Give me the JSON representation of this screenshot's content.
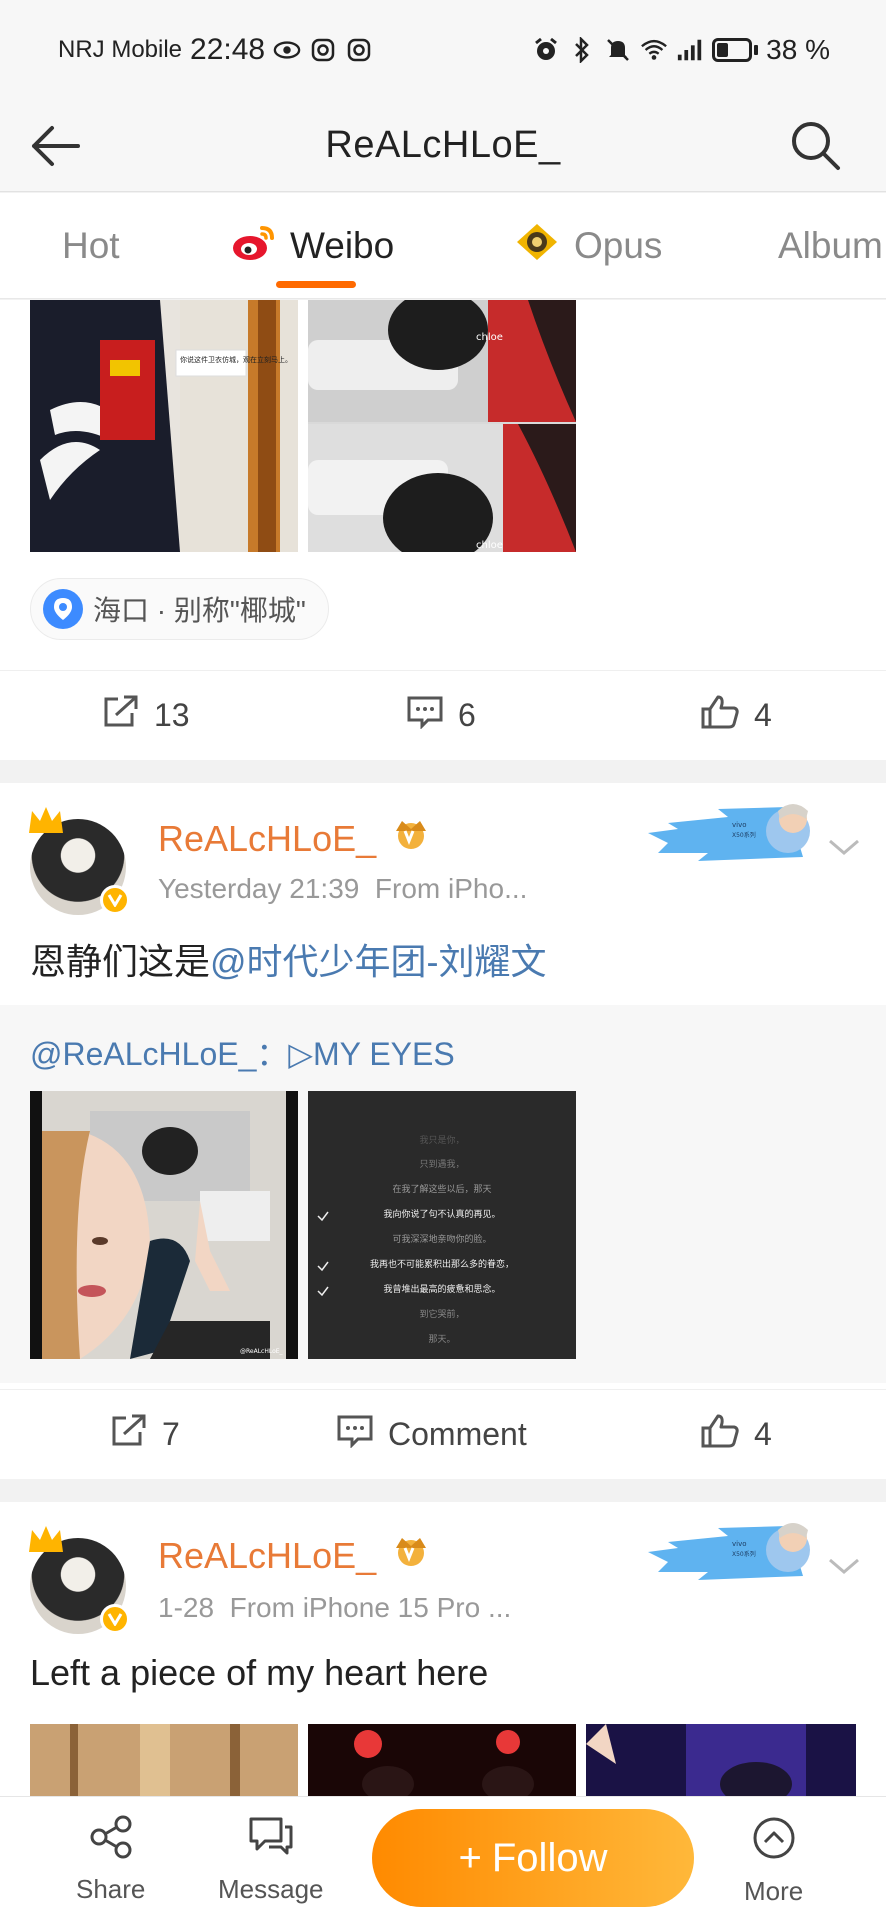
{
  "status_bar": {
    "carrier": "NRJ Mobile",
    "time": "22:48",
    "battery_percent": "38 %",
    "battery_level": 0.38,
    "icons": [
      "eye-icon",
      "instagram-icon",
      "instagram-icon",
      "alarm-icon",
      "bluetooth-icon",
      "mute-icon",
      "wifi-icon",
      "signal-icon",
      "battery-icon"
    ]
  },
  "header": {
    "title": "ReALcHLoE_",
    "back_icon": "arrow-left-icon",
    "search_icon": "search-icon"
  },
  "tabs": [
    {
      "label": "Hot",
      "active": false
    },
    {
      "label": "Weibo",
      "active": true,
      "icon": "weibo-logo-icon"
    },
    {
      "label": "Opus",
      "active": false,
      "icon": "opus-icon"
    },
    {
      "label": "Album",
      "active": false
    }
  ],
  "accent_color": "#ff6a00",
  "post1": {
    "image_texts": [
      "你说这件卫衣仿城，观在立刻马上。",
      "chloe",
      "chloe"
    ],
    "location": "海口 · 别称\"椰城\"",
    "repost_count": "13",
    "comment_count": "6",
    "like_count": "4"
  },
  "post2": {
    "username": "ReALcHLoE_",
    "time": "Yesterday 21:39",
    "source": "From iPho...",
    "text_prefix": "恩静们这是",
    "mention": "@时代少年团-刘耀文",
    "ad_text": "vivo",
    "ad_text2": "X50系列",
    "repost_author": "@ReALcHLoE_",
    "repost_sep": "：",
    "repost_text": "▷MY EYES",
    "image_texts": [
      "@ReALcHLoE_",
      "我只是你，",
      "只到遇我，",
      "在我了解这些以后，那天",
      "我向你说了句不认真的再见。",
      "可我深深地亲吻你的脸。",
      "我再也不可能累积出那么多的眷恋，",
      "我曾堆出最高的疲惫和思念。",
      "到它哭前，",
      "那天。"
    ],
    "repost_count": "7",
    "comment_label": "Comment",
    "like_count": "4"
  },
  "post3": {
    "username": "ReALcHLoE_",
    "time": "1-28",
    "source": "From iPhone 15 Pro ...",
    "text": "Left a piece of my heart here",
    "ad_text": "vivo",
    "ad_text2": "X50系列"
  },
  "bottom_bar": {
    "share_label": "Share",
    "message_label": "Message",
    "follow_label": "Follow",
    "follow_plus": "+",
    "more_label": "More"
  }
}
